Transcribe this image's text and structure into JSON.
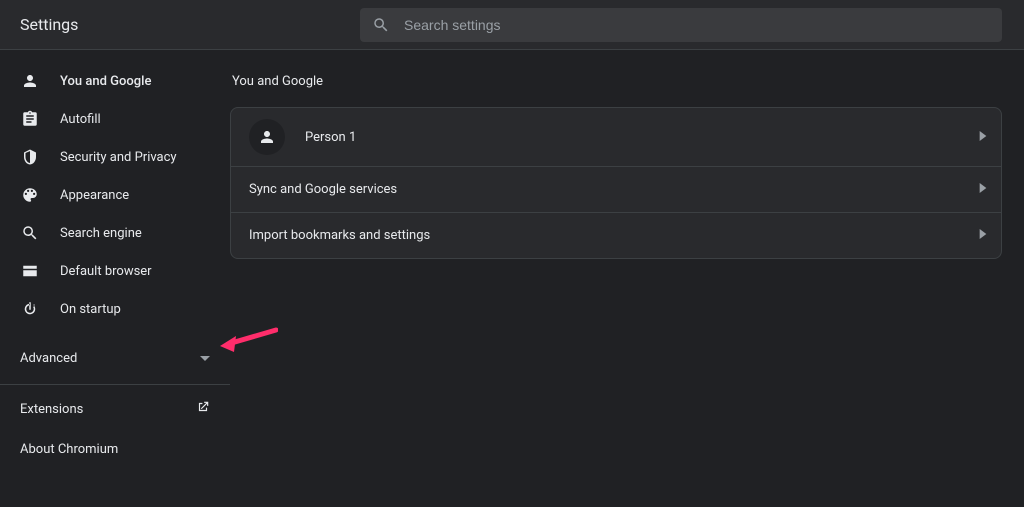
{
  "header": {
    "title": "Settings",
    "search_placeholder": "Search settings"
  },
  "sidebar": {
    "items": [
      {
        "icon": "person-icon",
        "label": "You and Google",
        "selected": true
      },
      {
        "icon": "autofill-icon",
        "label": "Autofill",
        "selected": false
      },
      {
        "icon": "shield-icon",
        "label": "Security and Privacy",
        "selected": false
      },
      {
        "icon": "palette-icon",
        "label": "Appearance",
        "selected": false
      },
      {
        "icon": "search-icon",
        "label": "Search engine",
        "selected": false
      },
      {
        "icon": "browser-icon",
        "label": "Default browser",
        "selected": false
      },
      {
        "icon": "power-icon",
        "label": "On startup",
        "selected": false
      }
    ],
    "advanced_label": "Advanced",
    "extensions_label": "Extensions",
    "about_label": "About Chromium"
  },
  "main": {
    "section_title": "You and Google",
    "profile_name": "Person 1",
    "rows": [
      "Sync and Google services",
      "Import bookmarks and settings"
    ]
  },
  "annotation": {
    "arrow_color": "#ff2d6b"
  }
}
